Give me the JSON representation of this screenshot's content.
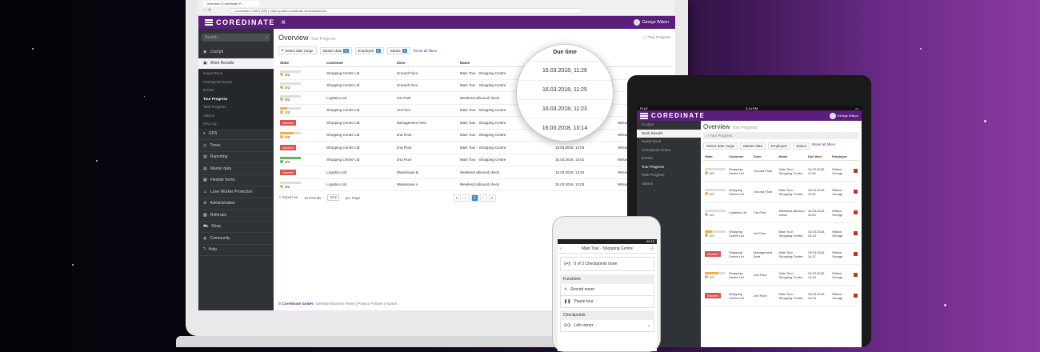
{
  "laptop": {
    "tab_title": "Overview | Coredinate P...",
    "url": "https://portal.coredinate.de/#/dashboard",
    "url_owner": "Coredinate GmbH [DE]",
    "brand": "COREDINATE",
    "user": "George Wilson",
    "search_placeholder": "Search",
    "sidebar": {
      "cockpit": "Cockpit",
      "work_results": "Work Results",
      "subs": [
        "Guard Book",
        "Checkpoint Scans",
        "Events",
        "Tour Progress",
        "Task Progress",
        "Alarms",
        "Key Log"
      ],
      "items": [
        "GPS",
        "Times",
        "Reporting",
        "Master data",
        "Flexible forms",
        "Lone Worker Protection",
        "Administration",
        "Referrals",
        "Shop",
        "Community",
        "Help"
      ]
    },
    "title": "Overview",
    "subtitle": "Tour Progress",
    "breadcrumb": "Tour Progress",
    "filters": {
      "date": "Select date range",
      "master": "Master data",
      "master_count": "0",
      "employee": "Employee",
      "employee_count": "0",
      "status": "Status",
      "status_count": "0",
      "reset": "Reset all filters"
    },
    "columns": {
      "state": "State",
      "customer": "Customer",
      "zone": "Zone",
      "name": "Name",
      "due": "Due time"
    },
    "rows": [
      {
        "state": "0/3",
        "customer": "Shopping Centre Ltd",
        "zone": "Ground Floor",
        "name": "Main Tour - Shopping Centre",
        "due": "",
        "emp": ""
      },
      {
        "state": "0/3",
        "customer": "Shopping Centre Ltd",
        "zone": "Ground Floor",
        "name": "Main Tour - Shopping Centre",
        "due": "",
        "emp": ""
      },
      {
        "state": "0/2",
        "customer": "Logistics Ltd",
        "zone": "Car Park",
        "name": "Weekend allround check",
        "due": "",
        "emp": ""
      },
      {
        "state": "1/3",
        "customer": "Shopping Centre Ltd",
        "zone": "1st Floor",
        "name": "Main Tour - Shopping Centre",
        "due": "",
        "emp": ""
      },
      {
        "state": "Aborted",
        "customer": "Shopping Centre Ltd",
        "zone": "Management Area",
        "name": "Main Tour - Shopping Centre",
        "due": "",
        "emp": "Wilson, George"
      },
      {
        "state": "2/3",
        "customer": "Shopping Centre Ltd",
        "zone": "2nd Floor",
        "name": "Main Tour - Shopping Centre",
        "due": "15.03.2018, 14:04",
        "emp": "Wilson, George"
      },
      {
        "state": "Aborted",
        "customer": "Shopping Centre Ltd",
        "zone": "2nd Floor",
        "name": "Main Tour - Shopping Centre",
        "due": "15.03.2018, 14:03",
        "emp": "Wilson, George"
      },
      {
        "state": "3/3",
        "customer": "Shopping Centre Ltd",
        "zone": "2nd Floor",
        "name": "Main Tour - Shopping Centre",
        "due": "15.03.2018, 14:01",
        "emp": "Wilson, George"
      },
      {
        "state": "Aborted",
        "customer": "Logistics Ltd",
        "zone": "Warehouse B",
        "name": "Weekend allround check",
        "due": "15.03.2018, 13:04",
        "emp": "Wilson, George"
      },
      {
        "state": "0/2",
        "customer": "Logistics Ltd",
        "zone": "Warehouse A",
        "name": "Weekend allround check",
        "due": "15.03.2018, 12:03",
        "emp": "Wilson, George"
      }
    ],
    "export": "Export as",
    "results": "10 Results",
    "per_page": "20",
    "per_page_label": "per Page",
    "page": "1",
    "footer_brand": "© Coredinate GmbH",
    "footer_links": "| General Business Terms | Privacy Policies | Imprint"
  },
  "magnifier": {
    "header": "Due time",
    "values": [
      "16.03.2018, 11:26",
      "16.03.2018, 11:25",
      "16.03.2018, 11:23",
      "16.03.2018, 10:14"
    ]
  },
  "tablet": {
    "carrier": "PLAY",
    "time": "2:14 PM",
    "brand": "COREDINATE",
    "user": "George Wilson",
    "title": "Overview",
    "subtitle": "Tour Progress",
    "crumb": "Tour Progress",
    "sidebar": [
      "Cockpit",
      "Work Results",
      "Guard Book",
      "Checkpoint Scans",
      "Events",
      "Tour Progress",
      "Task Progress",
      "Alarms"
    ],
    "filters": {
      "date": "Select date range",
      "master": "Master data",
      "employee": "Employee",
      "status": "Status",
      "reset": "Reset all filters"
    },
    "columns": [
      "State",
      "Customer",
      "Zone",
      "Name",
      "Due time",
      "Employee"
    ],
    "rows": [
      {
        "s": "0/3",
        "c": "Shopping Centre Ltd",
        "z": "Ground Floor",
        "n": "Main Tour - Shopping Centre",
        "d": "16.03.2018, 11:26",
        "e": "Wilson, George"
      },
      {
        "s": "0/3",
        "c": "Shopping Centre Ltd",
        "z": "Ground Floor",
        "n": "Main Tour - Shopping Centre",
        "d": "16.03.2018, 11:25",
        "e": "Wilson, George"
      },
      {
        "s": "0/2",
        "c": "Logistics Ltd",
        "z": "Car Park",
        "n": "Weekend allround check",
        "d": "16.03.2018, 11:23",
        "e": "Wilson, George"
      },
      {
        "s": "1/3",
        "c": "Shopping Centre Ltd",
        "z": "1st Floor",
        "n": "Main Tour - Shopping Centre",
        "d": "16.03.2018, 10:14",
        "e": "Wilson, George"
      },
      {
        "s": "Aborted",
        "c": "Shopping Centre Ltd",
        "z": "Management Area",
        "n": "Main Tour - Shopping Centre",
        "d": "15.03.2018, 14:27",
        "e": "Wilson, George"
      },
      {
        "s": "2/3",
        "c": "Shopping Centre Ltd",
        "z": "2nd Floor",
        "n": "Main Tour - Shopping Centre",
        "d": "15.03.2018, 14:04",
        "e": "Wilson, George"
      },
      {
        "s": "Aborted",
        "c": "Shopping Centre Ltd",
        "z": "2nd Floor",
        "n": "Main Tour - Shopping Centre",
        "d": "15.03.2018, 14:03",
        "e": "Wilson, George"
      }
    ]
  },
  "phone": {
    "time": "09:15",
    "title": "Main Tour - Shopping Centre",
    "checkpoints_done": "0 of 3 Checkpoints done",
    "functions": "Functions",
    "record": "Record event",
    "pause": "Pause tour",
    "checkpoints": "Checkpoints",
    "left_corner": "Left corner"
  }
}
